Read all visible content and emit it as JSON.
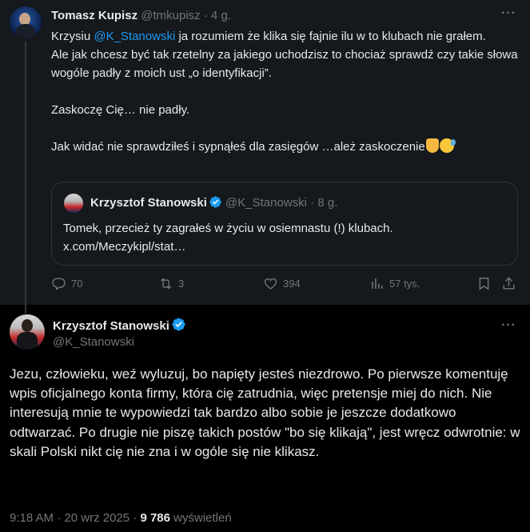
{
  "reply": {
    "author_name": "Tomasz Kupisz",
    "author_handle": "@tmkupisz",
    "separator": "·",
    "time_ago": "4 g.",
    "line1_before": "Krzysiu ",
    "mention": "@K_Stanowski",
    "line1_after": " ja rozumiem że klika się fajnie ilu w to klubach nie grałem.",
    "line2": "Ale jak chcesz być tak rzetelny za jakiego uchodzisz to chociaż sprawdź czy takie słowa wogóle  padły z moich ust „o identyfikacji”.",
    "line3": "Zaskoczę Cię… nie padły.",
    "line4": "Jak widać nie sprawdziłeś i sypnąłeś dla zasięgów …ależ zaskoczenie",
    "emoji_1": "thumbs-down-emoji",
    "emoji_2": "sweat-smile-emoji",
    "quote": {
      "author_name": "Krzysztof Stanowski",
      "author_handle": "@K_Stanowski",
      "separator": "·",
      "time_ago": "8 g.",
      "text": "Tomek, przecież ty zagrałeś w życiu w osiemnastu (!) klubach.",
      "link": "x.com/Meczykipl/stat…"
    },
    "actions": {
      "replies": "70",
      "reposts": "3",
      "likes": "394",
      "views": "57 tys."
    }
  },
  "main": {
    "author_name": "Krzysztof Stanowski",
    "author_handle": "@K_Stanowski",
    "text": "Jezu, człowieku, weź wyluzuj, bo napięty jesteś niezdrowo. Po pierwsze komentuję wpis oficjalnego konta firmy, która cię zatrudnia, więc pretensje miej do nich. Nie interesują mnie te wypowiedzi tak bardzo albo sobie je jeszcze dodatkowo odtwarzać. Po drugie nie piszę takich postów \"bo się klikają\", jest wręcz odwrotnie: w skali Polski nikt cię nie zna i w ogóle się nie klikasz.",
    "time": "9:18 AM",
    "separator": "·",
    "date": "20 wrz 2025",
    "separator2": "·",
    "views_count": "9 786",
    "views_label": "wyświetleń"
  },
  "colors": {
    "accent": "#1d9bf0",
    "muted": "#71767b",
    "reply_bg": "#15181c",
    "page_bg": "#000000"
  }
}
